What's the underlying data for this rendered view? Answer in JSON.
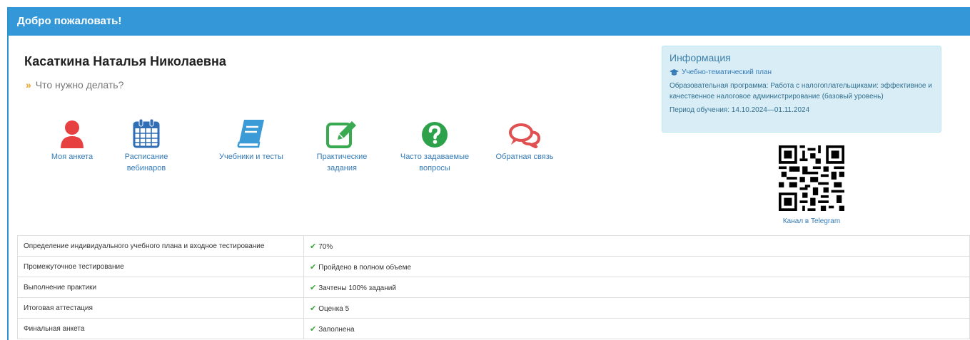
{
  "header": {
    "title": "Добро пожаловать!"
  },
  "user": {
    "name": "Касаткина Наталья Николаевна"
  },
  "todo": {
    "arrows": "»",
    "label": "Что нужно делать?"
  },
  "menu": [
    {
      "label": "Моя анкета",
      "icon": "user-icon",
      "color": "#e74040"
    },
    {
      "label": "Расписание вебинаров",
      "icon": "calendar-icon",
      "color": "#2f6db5"
    },
    {
      "label": "Учебники и тесты",
      "icon": "book-icon",
      "color": "#3b9bd6"
    },
    {
      "label": "Практические задания",
      "icon": "edit-icon",
      "color": "#3aaa52"
    },
    {
      "label": "Часто задаваемые вопросы",
      "icon": "question-icon",
      "color": "#2ea24a"
    },
    {
      "label": "Обратная связь",
      "icon": "chat-icon",
      "color": "#e05050"
    }
  ],
  "info": {
    "title": "Информация",
    "plan_link": "Учебно-тематический план",
    "program": "Образовательная программа: Работа с налогоплательщиками: эффективное и качественное налоговое администрирование (базовый уровень)",
    "period": "Период обучения: 14.10.2024—01.11.2024"
  },
  "qr": {
    "caption": "Канал в Telegram"
  },
  "progress": [
    {
      "stage": "Определение индивидуального учебного плана и входное тестирование",
      "status": "70%"
    },
    {
      "stage": "Промежуточное тестирование",
      "status": "Пройдено в полном объеме"
    },
    {
      "stage": "Выполнение практики",
      "status": "Зачтены 100% заданий"
    },
    {
      "stage": "Итоговая аттестация",
      "status": "Оценка 5"
    },
    {
      "stage": "Финальная анкета",
      "status": "Заполнена"
    }
  ]
}
